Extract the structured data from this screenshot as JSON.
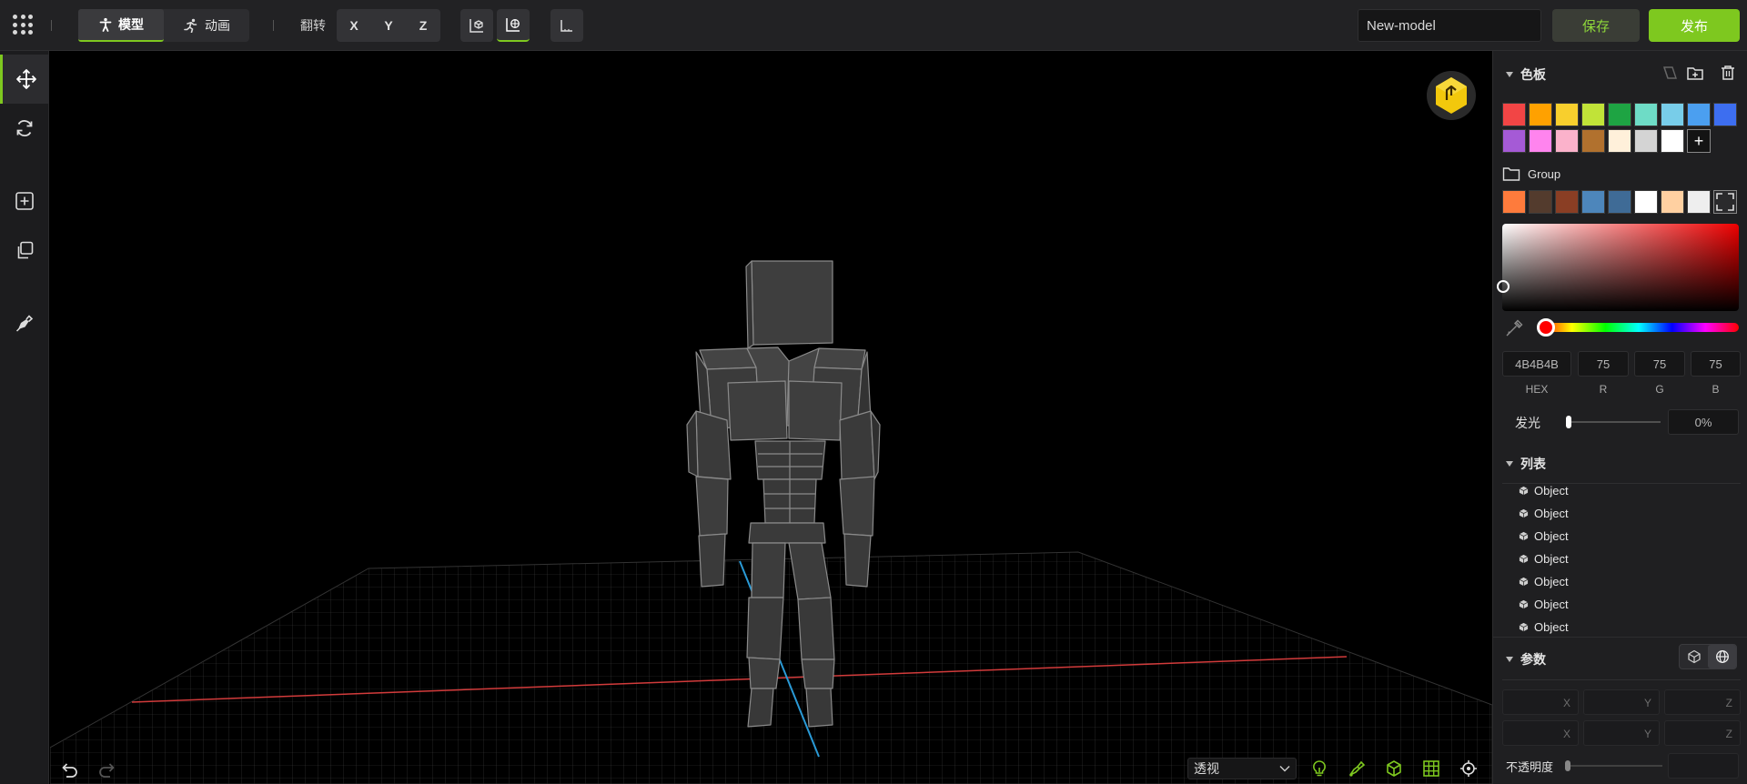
{
  "topbar": {
    "mode_model": "模型",
    "mode_animation": "动画",
    "flip_label": "翻转",
    "axes": [
      "X",
      "Y",
      "Z"
    ],
    "model_name": "New-model",
    "save_label": "保存",
    "publish_label": "发布"
  },
  "left_toolbar": {
    "tools": [
      "move-tool",
      "rotate-tool",
      "add-object",
      "duplicate",
      "paint-brush"
    ]
  },
  "viewport": {
    "view_mode": "透视",
    "bottom_icons": [
      "light-bulb-icon",
      "paint-icon",
      "cube-icon",
      "grid-icon",
      "focus-icon"
    ]
  },
  "palette": {
    "title": "色板",
    "colors": [
      "#f24545",
      "#ffa100",
      "#f8cf2d",
      "#c1e338",
      "#1ea443",
      "#6edcc6",
      "#78cde9",
      "#4b9ff0",
      "#3d6ef0",
      "#a55ad6",
      "#ff84ee",
      "#fbb2cb",
      "#b1712e",
      "#fff0da",
      "#d4d4d4",
      "#ffffff"
    ],
    "group_label": "Group",
    "group_colors": [
      "#fe7b3c",
      "#533b2d",
      "#8a3e24",
      "#4d86bb",
      "#3f6b96",
      "#ffffff",
      "#ffd0a1",
      "#eeeeee"
    ]
  },
  "color_picker": {
    "hex": "4B4B4B",
    "r": "75",
    "g": "75",
    "b": "75",
    "hex_label": "HEX",
    "r_label": "R",
    "g_label": "G",
    "b_label": "B",
    "glow_label": "发光",
    "glow_value": "0%",
    "glow_level": 0,
    "hue": 0,
    "current_color": "#4b4b4b",
    "accent_color": "#7ec81f"
  },
  "object_list": {
    "title": "列表",
    "items": [
      "Object",
      "Object",
      "Object",
      "Object",
      "Object",
      "Object",
      "Object"
    ]
  },
  "params": {
    "title": "参数",
    "row1": [
      "X",
      "Y",
      "Z"
    ],
    "row2": [
      "X",
      "Y",
      "Z"
    ],
    "opacity_label": "不透明度"
  }
}
